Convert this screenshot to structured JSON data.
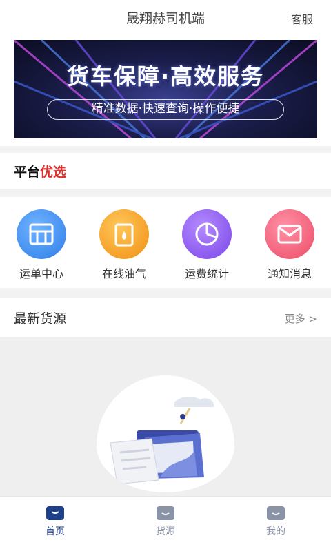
{
  "header": {
    "title": "晟翔赫司机端",
    "service": "客服"
  },
  "banner": {
    "headline": "货车保障·高效服务",
    "subline": "精准数据·快速查询·操作便捷"
  },
  "platform": {
    "label_prefix": "平台",
    "label_highlight": "优选"
  },
  "features": [
    {
      "label": "运单中心",
      "icon": "waybill-icon",
      "color": "#3d8bf2"
    },
    {
      "label": "在线油气",
      "icon": "fuel-icon",
      "color": "#f4a21c"
    },
    {
      "label": "运费统计",
      "icon": "pie-chart-icon",
      "color": "#8e5cf0"
    },
    {
      "label": "通知消息",
      "icon": "mail-icon",
      "color": "#f05a73"
    }
  ],
  "latest": {
    "title": "最新货源",
    "more": "更多 >"
  },
  "tabs": [
    {
      "label": "首页",
      "active": true
    },
    {
      "label": "货源",
      "active": false
    },
    {
      "label": "我的",
      "active": false
    }
  ],
  "colors": {
    "active_tab": "#1e3f8a",
    "inactive_tab": "#8a94a8",
    "accent_red": "#e0312b"
  }
}
